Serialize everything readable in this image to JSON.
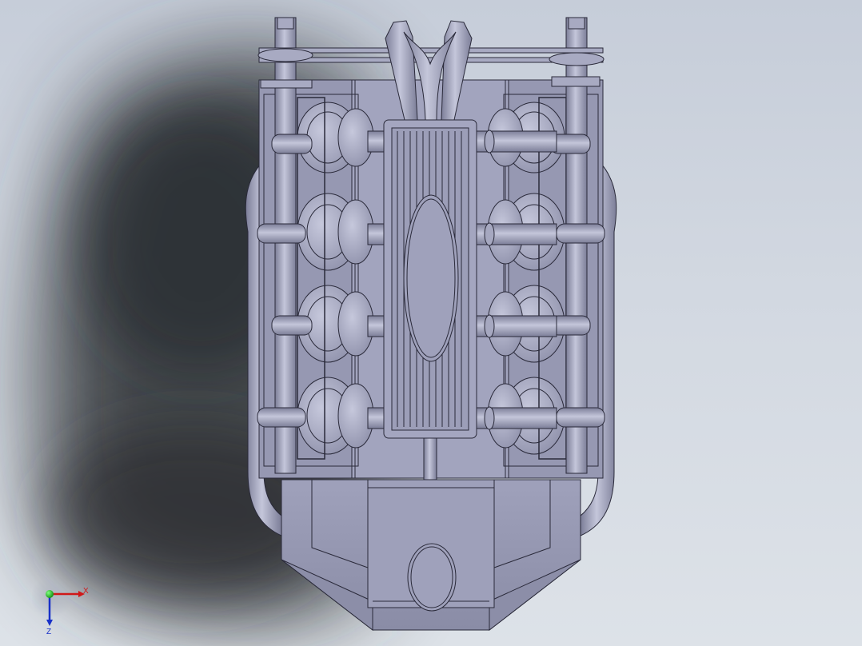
{
  "viewport": {
    "background_top": "#c6cdd9",
    "background_bottom": "#dde2e8",
    "model_fill": "#9a9cb6",
    "model_fill_light": "#b8bad0",
    "model_fill_dark": "#7c7e98",
    "edge_color": "#2a2a3a",
    "shadow_color": "#2e3036"
  },
  "triad": {
    "x_label": "X",
    "z_label": "Z",
    "x_color": "#d01818",
    "y_color": "#18b018",
    "z_color": "#1830c8"
  }
}
